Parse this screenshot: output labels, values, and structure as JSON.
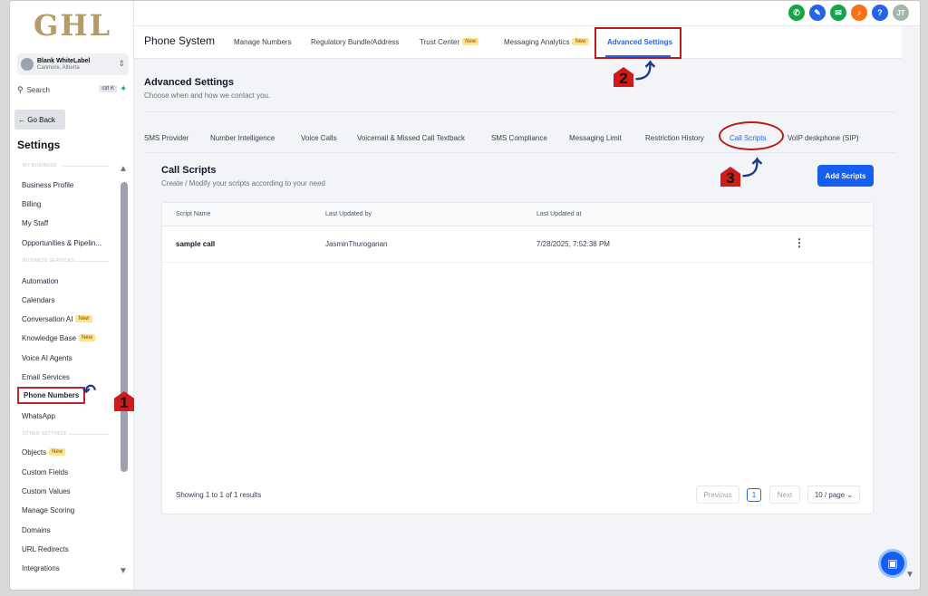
{
  "brand": {
    "logo_text": "GHL"
  },
  "account": {
    "name": "Blank WhiteLabel",
    "location": "Canmore, Alberta"
  },
  "search": {
    "label": "Search",
    "shortcut": "ctrl K"
  },
  "sidebar": {
    "go_back": "← Go Back",
    "heading": "Settings",
    "sections": {
      "my_business": "MY BUSINESS",
      "business_services": "BUSINESS SERVICES",
      "other_settings": "OTHER SETTINGS"
    },
    "items": [
      {
        "label": "Business Profile"
      },
      {
        "label": "Billing"
      },
      {
        "label": "My Staff"
      },
      {
        "label": "Opportunities & Pipelin..."
      },
      {
        "label": "Automation"
      },
      {
        "label": "Calendars"
      },
      {
        "label": "Conversation AI",
        "badge": "New"
      },
      {
        "label": "Knowledge Base",
        "badge": "New"
      },
      {
        "label": "Voice AI Agents"
      },
      {
        "label": "Email Services"
      },
      {
        "label": "Phone Numbers"
      },
      {
        "label": "WhatsApp"
      },
      {
        "label": "Objects",
        "badge": "New"
      },
      {
        "label": "Custom Fields"
      },
      {
        "label": "Custom Values"
      },
      {
        "label": "Manage Scoring"
      },
      {
        "label": "Domains"
      },
      {
        "label": "URL Redirects"
      },
      {
        "label": "Integrations"
      }
    ]
  },
  "topbar": {
    "avatar": "JT"
  },
  "phone_system": {
    "title": "Phone System",
    "tabs": [
      {
        "label": "Manage Numbers"
      },
      {
        "label": "Regulatory Bundle/Address"
      },
      {
        "label": "Trust Center",
        "badge": "New"
      },
      {
        "label": "Messaging Analytics",
        "badge": "New"
      },
      {
        "label": "Advanced Settings"
      }
    ]
  },
  "advanced": {
    "title": "Advanced Settings",
    "subtitle": "Choose when and how we contact you.",
    "tabs": [
      {
        "label": "SMS Provider"
      },
      {
        "label": "Number Intelligence"
      },
      {
        "label": "Voice Calls"
      },
      {
        "label": "Voicemail & Missed Call Textback"
      },
      {
        "label": "SMS Compliance"
      },
      {
        "label": "Messaging Limit"
      },
      {
        "label": "Restriction History"
      },
      {
        "label": "Call Scripts"
      },
      {
        "label": "VoIP deskphone (SIP)"
      }
    ]
  },
  "call_scripts": {
    "title": "Call Scripts",
    "subtitle": "Create / Modify your scripts according to your need",
    "add_button": "Add Scripts",
    "columns": [
      "Script Name",
      "Last Updated by",
      "Last Updated at"
    ],
    "rows": [
      {
        "name": "sample call",
        "updated_by": "JasminThuroganan",
        "updated_at": "7/28/2025, 7:52:38 PM"
      }
    ],
    "showing": "Showing 1 to 1 of 1 results",
    "pagination": {
      "previous": "Previous",
      "page": "1",
      "next": "Next",
      "per_page": "10 / page ⌄"
    }
  },
  "annotations": {
    "step1": "1",
    "step2": "2",
    "step3": "3"
  },
  "colors": {
    "accent": "#155eef",
    "annotation_red": "#b91c1c",
    "logo_gold": "#b39b6a"
  }
}
